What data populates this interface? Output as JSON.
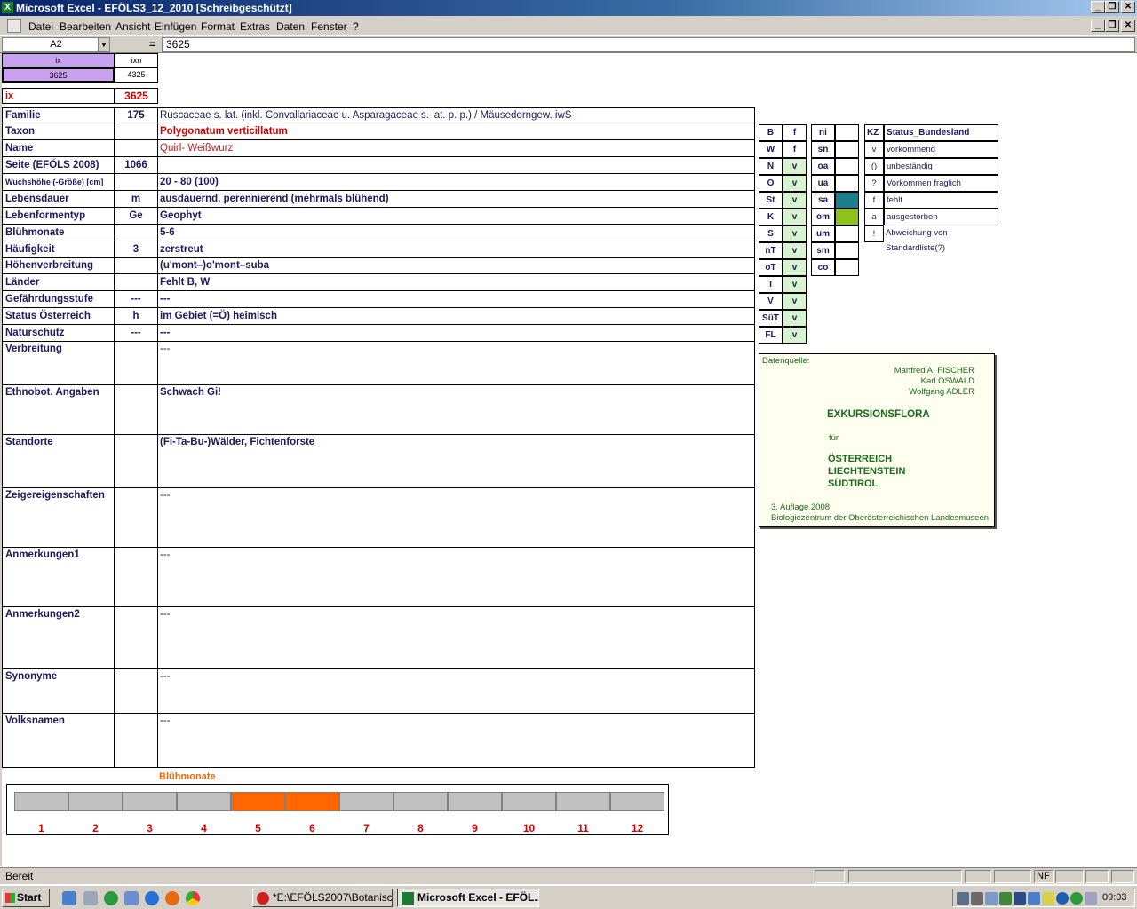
{
  "window": {
    "title": "Microsoft Excel - EFÖLS3_12_2010  [Schreibgeschützt]"
  },
  "menu": [
    "Datei",
    "Bearbeiten",
    "Ansicht",
    "Einfügen",
    "Format",
    "Extras",
    "Daten",
    "Fenster",
    "?"
  ],
  "formula": {
    "cell_ref": "A2",
    "fx": "=",
    "value": "3625"
  },
  "ix_header": {
    "ix_label": "ix",
    "ixn_label": "ixn",
    "ix_value": "3625",
    "ixn_value": "4325"
  },
  "ix_row": {
    "label": "ix",
    "value": "3625"
  },
  "rows": [
    {
      "label": "Familie",
      "mid": "175",
      "value": "Ruscaceae s. lat. (inkl. Convallariaceae u. Asparagaceae s. lat. p. p.)  /  Mäusedorngew. iwS"
    },
    {
      "label": "Taxon",
      "mid": "",
      "value": "Polygonatum verticillatum"
    },
    {
      "label": "Name",
      "mid": "",
      "value": "Quirl- Weißwurz"
    },
    {
      "label": "Seite (EFÖLS 2008)",
      "mid": "1066",
      "value": ""
    },
    {
      "label": "Wuchshöhe (-Größe) [cm]",
      "mid": "",
      "value": " 20 - 80 (100)"
    },
    {
      "label": "Lebensdauer",
      "mid": "m",
      "value": "ausdauernd, perennierend (mehrmals blühend)"
    },
    {
      "label": "Lebenformentyp",
      "mid": "Ge",
      "value": "Geophyt"
    },
    {
      "label": "Blühmonate",
      "mid": "",
      "value": " 5-6"
    },
    {
      "label": "Häufigkeit",
      "mid": "3",
      "value": "zerstreut"
    },
    {
      "label": "Höhenverbreitung",
      "mid": "",
      "value": "(u'mont–)o'mont–suba"
    },
    {
      "label": "Länder",
      "mid": "",
      "value": "Fehlt B, W"
    },
    {
      "label": "Gefährdungsstufe",
      "mid": "---",
      "value": "  ---"
    },
    {
      "label": "Status Österreich",
      "mid": "h",
      "value": "im Gebiet (=Ö) heimisch"
    },
    {
      "label": "Naturschutz",
      "mid": "---",
      "value": " ---"
    }
  ],
  "big_rows": [
    {
      "label": "Verbreitung",
      "value": " ---"
    },
    {
      "label": "Ethnobot. Angaben",
      "value": "Schwach Gi!"
    },
    {
      "label": "Standorte",
      "value": "(Fi-Ta-Bu-)Wälder, Fichtenforste"
    },
    {
      "label": "Zeigereigenschaften",
      "value": "---"
    },
    {
      "label": "Anmerkungen1",
      "value": "---"
    },
    {
      "label": "Anmerkungen2",
      "value": "---"
    },
    {
      "label": "Synonyme",
      "value": "---"
    },
    {
      "label": "Volksnamen",
      "value": "---"
    }
  ],
  "states": [
    {
      "k": "B",
      "v": "f"
    },
    {
      "k": "W",
      "v": "f"
    },
    {
      "k": "N",
      "v": "v"
    },
    {
      "k": "O",
      "v": "v"
    },
    {
      "k": "St",
      "v": "v"
    },
    {
      "k": "K",
      "v": "v"
    },
    {
      "k": "S",
      "v": "v"
    },
    {
      "k": "nT",
      "v": "v"
    },
    {
      "k": "oT",
      "v": "v"
    },
    {
      "k": "T",
      "v": "v"
    },
    {
      "k": "V",
      "v": "v"
    },
    {
      "k": "SüT",
      "v": "v"
    },
    {
      "k": "FL",
      "v": "v"
    }
  ],
  "zones": [
    {
      "k": "ni",
      "color": ""
    },
    {
      "k": "sn",
      "color": ""
    },
    {
      "k": "oa",
      "color": ""
    },
    {
      "k": "ua",
      "color": ""
    },
    {
      "k": "sa",
      "color": "#1a7f8a"
    },
    {
      "k": "om",
      "color": "#8cc21a"
    },
    {
      "k": "um",
      "color": ""
    },
    {
      "k": "sm",
      "color": ""
    },
    {
      "k": "co",
      "color": ""
    }
  ],
  "status_table": {
    "kz_label": "KZ",
    "title": "Status_Bundesland",
    "rows": [
      {
        "k": "v",
        "t": "vorkommend"
      },
      {
        "k": "()",
        "t": "unbeständig"
      },
      {
        "k": "?",
        "t": "Vorkommen fraglich"
      },
      {
        "k": "f",
        "t": "fehlt"
      },
      {
        "k": "a",
        "t": "ausgestorben"
      },
      {
        "k": "!",
        "t": "Abweichung von Standardliste(?)"
      }
    ]
  },
  "source": {
    "heading": "Datenquelle:",
    "author1": "Manfred A. FISCHER",
    "author2": "Karl OSWALD",
    "author3": "Wolfgang ADLER",
    "book": "EXKURSIONSFLORA",
    "fuer": "für",
    "country1": "ÖSTERREICH",
    "country2": "LIECHTENSTEIN",
    "country3": "SÜDTIROL",
    "edition": "3. Auflage 2008",
    "publisher": "Biologiezentrum der Oberösterreichischen Landesmuseen"
  },
  "bloom": {
    "title": "Blühmonate",
    "months": [
      "1",
      "2",
      "3",
      "4",
      "5",
      "6",
      "7",
      "8",
      "9",
      "10",
      "11",
      "12"
    ],
    "active": [
      5,
      6
    ],
    "active_color": "#ff6600"
  },
  "statusbar": {
    "text": "Bereit",
    "nf": "NF"
  },
  "taskbar": {
    "start": "Start",
    "tasks": [
      "*E:\\EFÖLS2007\\Botanisc...",
      "Microsoft Excel - EFÖL..."
    ],
    "clock": "09:03"
  }
}
